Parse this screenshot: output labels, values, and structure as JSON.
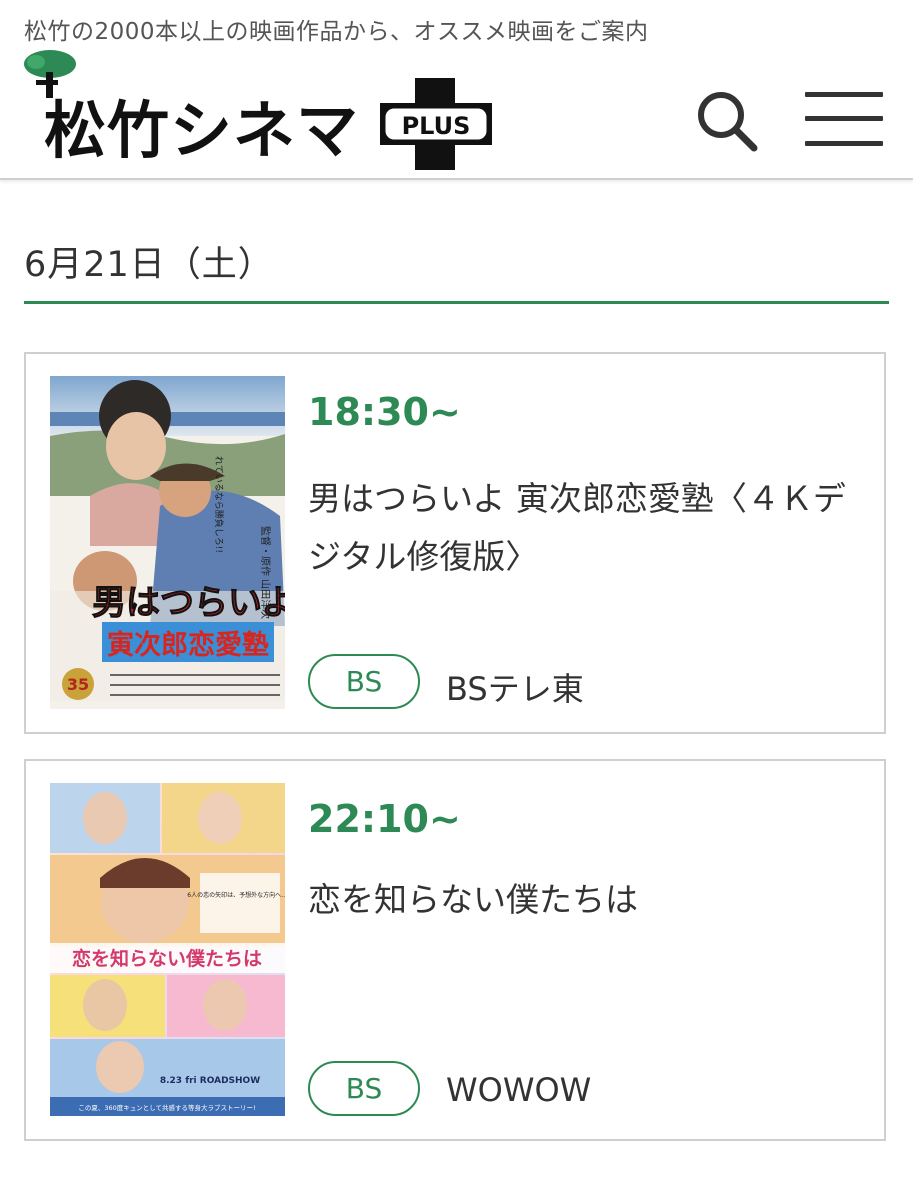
{
  "header": {
    "tagline": "松竹の2000本以上の映画作品から、オススメ映画をご案内",
    "logo_text": "松竹シネマ",
    "logo_plus": "PLUS"
  },
  "date_heading": "6月21日（土）",
  "colors": {
    "accent": "#2d8a54",
    "border": "#cfcfcf",
    "text": "#333333"
  },
  "schedule": [
    {
      "time": "18:30~",
      "title": "男はつらいよ 寅次郎恋愛塾〈４Ｋデジタル修復版〉",
      "badge": "BS",
      "channel": "BSテレ東",
      "poster": {
        "title_text": "男はつらいよ",
        "subtitle_text": "寅次郎恋愛塾",
        "catch": "れているなら勝負しろ!!",
        "credit": "監督・原作 山田洋次",
        "badge": "35"
      }
    },
    {
      "time": "22:10~",
      "title": "恋を知らない僕たちは",
      "badge": "BS",
      "channel": "WOWOW",
      "poster": {
        "title_text": "恋を知らない僕たちは",
        "catch": "6人の恋の矢印は、予想外な方向へ…!?",
        "release": "8.23 fri ROADSHOW",
        "bottom_text": "この夏、360度キュンとして共感する等身大ラブストーリー!"
      }
    }
  ]
}
